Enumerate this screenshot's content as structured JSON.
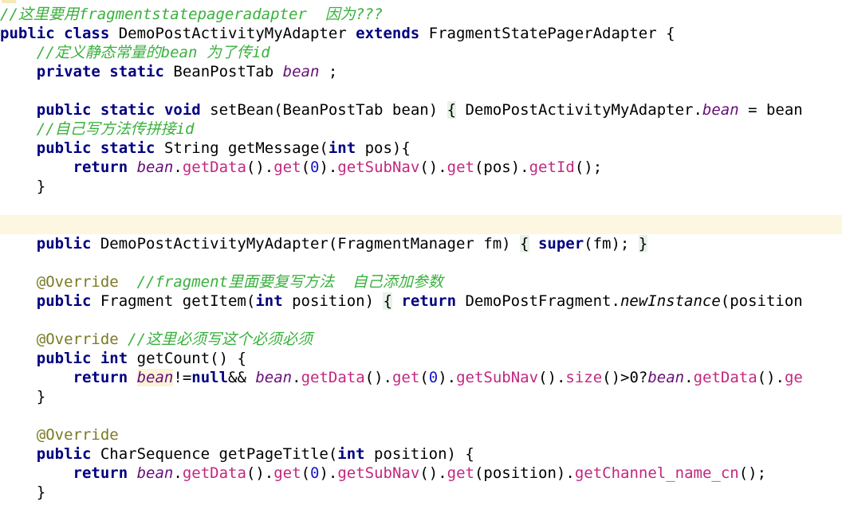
{
  "editor": {
    "lines": [
      {
        "id": "l1",
        "highlight": false,
        "tokens": [
          {
            "t": "cm",
            "v": "//这里要用fragmentstatepageradapter  因为???"
          }
        ]
      },
      {
        "id": "l2",
        "highlight": false,
        "tokens": [
          {
            "t": "kw",
            "v": "public"
          },
          {
            "t": "p",
            "v": " "
          },
          {
            "t": "kw",
            "v": "class"
          },
          {
            "t": "p",
            "v": " DemoPostActivityMyAdapter "
          },
          {
            "t": "kw",
            "v": "extends"
          },
          {
            "t": "p",
            "v": " FragmentStatePagerAdapter {"
          }
        ]
      },
      {
        "id": "l3",
        "highlight": false,
        "tokens": [
          {
            "t": "p",
            "v": "    "
          },
          {
            "t": "cm",
            "v": "//定义静态常量的bean 为了传id"
          }
        ]
      },
      {
        "id": "l4",
        "highlight": false,
        "tokens": [
          {
            "t": "p",
            "v": "    "
          },
          {
            "t": "kw",
            "v": "private"
          },
          {
            "t": "p",
            "v": " "
          },
          {
            "t": "kw",
            "v": "static"
          },
          {
            "t": "p",
            "v": " BeanPostTab "
          },
          {
            "t": "fld",
            "v": "bean"
          },
          {
            "t": "p",
            "v": " ;"
          }
        ]
      },
      {
        "id": "l5",
        "highlight": false,
        "tokens": []
      },
      {
        "id": "l6",
        "highlight": false,
        "tokens": [
          {
            "t": "p",
            "v": "    "
          },
          {
            "t": "kw",
            "v": "public"
          },
          {
            "t": "p",
            "v": " "
          },
          {
            "t": "kw",
            "v": "static"
          },
          {
            "t": "p",
            "v": " "
          },
          {
            "t": "kw",
            "v": "void"
          },
          {
            "t": "p",
            "v": " setBean(BeanPostTab bean) "
          },
          {
            "t": "brace",
            "v": "{"
          },
          {
            "t": "p",
            "v": " DemoPostActivityMyAdapter."
          },
          {
            "t": "fld",
            "v": "bean"
          },
          {
            "t": "p",
            "v": " = bean"
          }
        ]
      },
      {
        "id": "l7",
        "highlight": false,
        "tokens": [
          {
            "t": "p",
            "v": "    "
          },
          {
            "t": "cm",
            "v": "//自己写方法传拼接id"
          }
        ]
      },
      {
        "id": "l8",
        "highlight": false,
        "tokens": [
          {
            "t": "p",
            "v": "    "
          },
          {
            "t": "kw",
            "v": "public"
          },
          {
            "t": "p",
            "v": " "
          },
          {
            "t": "kw",
            "v": "static"
          },
          {
            "t": "p",
            "v": " String getMessage("
          },
          {
            "t": "kw",
            "v": "int"
          },
          {
            "t": "p",
            "v": " pos){"
          }
        ]
      },
      {
        "id": "l9",
        "highlight": false,
        "tokens": [
          {
            "t": "p",
            "v": "        "
          },
          {
            "t": "kw",
            "v": "return"
          },
          {
            "t": "p",
            "v": " "
          },
          {
            "t": "fld",
            "v": "bean"
          },
          {
            "t": "p",
            "v": "."
          },
          {
            "t": "mth",
            "v": "getData"
          },
          {
            "t": "p",
            "v": "()."
          },
          {
            "t": "mth",
            "v": "get"
          },
          {
            "t": "p",
            "v": "("
          },
          {
            "t": "num",
            "v": "0"
          },
          {
            "t": "p",
            "v": ")."
          },
          {
            "t": "mth",
            "v": "getSubNav"
          },
          {
            "t": "p",
            "v": "()."
          },
          {
            "t": "mth",
            "v": "get"
          },
          {
            "t": "p",
            "v": "(pos)."
          },
          {
            "t": "mth",
            "v": "getId"
          },
          {
            "t": "p",
            "v": "();"
          }
        ]
      },
      {
        "id": "l10",
        "highlight": false,
        "tokens": [
          {
            "t": "p",
            "v": "    }"
          }
        ]
      },
      {
        "id": "l11",
        "highlight": false,
        "tokens": []
      },
      {
        "id": "l12",
        "highlight": true,
        "tokens": []
      },
      {
        "id": "l13",
        "highlight": false,
        "tokens": [
          {
            "t": "p",
            "v": "    "
          },
          {
            "t": "kw",
            "v": "public"
          },
          {
            "t": "p",
            "v": " DemoPostActivityMyAdapter(FragmentManager fm) "
          },
          {
            "t": "brace",
            "v": "{"
          },
          {
            "t": "p",
            "v": " "
          },
          {
            "t": "kw",
            "v": "super"
          },
          {
            "t": "p",
            "v": "(fm); "
          },
          {
            "t": "brace",
            "v": "}"
          }
        ]
      },
      {
        "id": "l14",
        "highlight": false,
        "tokens": []
      },
      {
        "id": "l15",
        "highlight": false,
        "tokens": [
          {
            "t": "p",
            "v": "    "
          },
          {
            "t": "ann",
            "v": "@Override"
          },
          {
            "t": "p",
            "v": "  "
          },
          {
            "t": "cm",
            "v": "//fragment里面要复写方法  自己添加参数"
          }
        ]
      },
      {
        "id": "l16",
        "highlight": false,
        "tokens": [
          {
            "t": "p",
            "v": "    "
          },
          {
            "t": "kw",
            "v": "public"
          },
          {
            "t": "p",
            "v": " Fragment getItem("
          },
          {
            "t": "kw",
            "v": "int"
          },
          {
            "t": "p",
            "v": " position) "
          },
          {
            "t": "brace",
            "v": "{"
          },
          {
            "t": "p",
            "v": " "
          },
          {
            "t": "kw",
            "v": "return"
          },
          {
            "t": "p",
            "v": " DemoPostFragment."
          },
          {
            "t": "stat",
            "v": "newInstance"
          },
          {
            "t": "p",
            "v": "(position"
          }
        ]
      },
      {
        "id": "l17",
        "highlight": false,
        "tokens": []
      },
      {
        "id": "l18",
        "highlight": false,
        "tokens": [
          {
            "t": "p",
            "v": "    "
          },
          {
            "t": "ann",
            "v": "@Override"
          },
          {
            "t": "p",
            "v": " "
          },
          {
            "t": "cm",
            "v": "//这里必须写这个必须必须"
          }
        ]
      },
      {
        "id": "l19",
        "highlight": false,
        "tokens": [
          {
            "t": "p",
            "v": "    "
          },
          {
            "t": "kw",
            "v": "public"
          },
          {
            "t": "p",
            "v": " "
          },
          {
            "t": "kw",
            "v": "int"
          },
          {
            "t": "p",
            "v": " getCount() {"
          }
        ]
      },
      {
        "id": "l20",
        "highlight": false,
        "tokens": [
          {
            "t": "p",
            "v": "        "
          },
          {
            "t": "kw",
            "v": "return"
          },
          {
            "t": "p",
            "v": " "
          },
          {
            "t": "fldhl",
            "v": "bean"
          },
          {
            "t": "p",
            "v": "!="
          },
          {
            "t": "kw",
            "v": "null"
          },
          {
            "t": "p",
            "v": "&& "
          },
          {
            "t": "fld",
            "v": "bean"
          },
          {
            "t": "p",
            "v": "."
          },
          {
            "t": "mth",
            "v": "getData"
          },
          {
            "t": "p",
            "v": "()."
          },
          {
            "t": "mth",
            "v": "get"
          },
          {
            "t": "p",
            "v": "("
          },
          {
            "t": "num",
            "v": "0"
          },
          {
            "t": "p",
            "v": ")."
          },
          {
            "t": "mth",
            "v": "getSubNav"
          },
          {
            "t": "p",
            "v": "()."
          },
          {
            "t": "mth",
            "v": "size"
          },
          {
            "t": "p",
            "v": "()>0?"
          },
          {
            "t": "fld",
            "v": "bean"
          },
          {
            "t": "p",
            "v": "."
          },
          {
            "t": "mth",
            "v": "getData"
          },
          {
            "t": "p",
            "v": "()."
          },
          {
            "t": "mth",
            "v": "ge"
          }
        ]
      },
      {
        "id": "l21",
        "highlight": false,
        "tokens": [
          {
            "t": "p",
            "v": "    }"
          }
        ]
      },
      {
        "id": "l22",
        "highlight": false,
        "tokens": []
      },
      {
        "id": "l23",
        "highlight": false,
        "tokens": [
          {
            "t": "p",
            "v": "    "
          },
          {
            "t": "ann",
            "v": "@Override"
          }
        ]
      },
      {
        "id": "l24",
        "highlight": false,
        "tokens": [
          {
            "t": "p",
            "v": "    "
          },
          {
            "t": "kw",
            "v": "public"
          },
          {
            "t": "p",
            "v": " CharSequence getPageTitle("
          },
          {
            "t": "kw",
            "v": "int"
          },
          {
            "t": "p",
            "v": " position) {"
          }
        ]
      },
      {
        "id": "l25",
        "highlight": false,
        "tokens": [
          {
            "t": "p",
            "v": "        "
          },
          {
            "t": "kw",
            "v": "return"
          },
          {
            "t": "p",
            "v": " "
          },
          {
            "t": "fld",
            "v": "bean"
          },
          {
            "t": "p",
            "v": "."
          },
          {
            "t": "mth",
            "v": "getData"
          },
          {
            "t": "p",
            "v": "()."
          },
          {
            "t": "mth",
            "v": "get"
          },
          {
            "t": "p",
            "v": "("
          },
          {
            "t": "num",
            "v": "0"
          },
          {
            "t": "p",
            "v": ")."
          },
          {
            "t": "mth",
            "v": "getSubNav"
          },
          {
            "t": "p",
            "v": "()."
          },
          {
            "t": "mth",
            "v": "get"
          },
          {
            "t": "p",
            "v": "(position)."
          },
          {
            "t": "mth",
            "v": "getChannel_name_cn"
          },
          {
            "t": "p",
            "v": "();"
          }
        ]
      },
      {
        "id": "l26",
        "highlight": false,
        "tokens": [
          {
            "t": "p",
            "v": "    }"
          }
        ]
      }
    ]
  }
}
